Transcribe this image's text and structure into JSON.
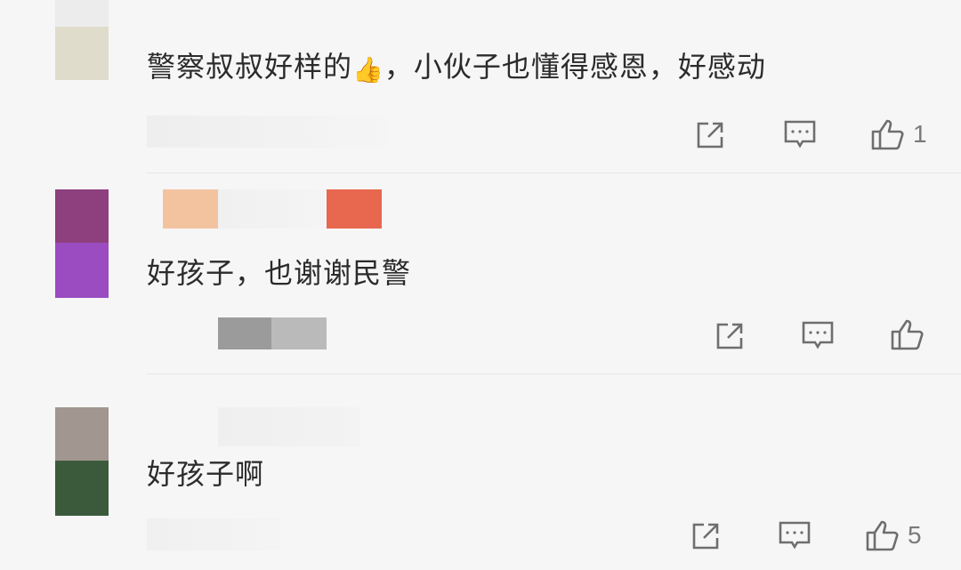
{
  "comments": [
    {
      "text_before_emoji": "警察叔叔好样的",
      "emoji": "👍",
      "text_after_emoji": "，小伙子也懂得感恩，好感动",
      "like_count": "1",
      "avatar_colors": [
        "#ececec",
        "#e0dccc",
        "#f1f1f1",
        "#f3f3f3"
      ]
    },
    {
      "text": "好孩子，也谢谢民警",
      "like_count": "",
      "avatar_colors": [
        "#8e3f7e",
        "#9b4cc0",
        "#f4f4f4",
        "#f1f1f1"
      ],
      "username_mask_colors": [
        "#f3c3a0",
        "#e8674f"
      ],
      "meta_mask_colors": [
        "#9b9b9b",
        "#bababa"
      ]
    },
    {
      "text": "好孩子啊",
      "like_count": "5",
      "avatar_colors": [
        "#a19690",
        "#3b5a3c",
        "#f3f3f3"
      ]
    }
  ],
  "icons": {
    "share": "share-icon",
    "comment": "comment-icon",
    "like": "thumbs-up-icon"
  },
  "colors": {
    "background": "#f6f6f6",
    "icon": "#6e6e6e",
    "text": "#2b2b2b",
    "divider": "#e6e6e6"
  }
}
